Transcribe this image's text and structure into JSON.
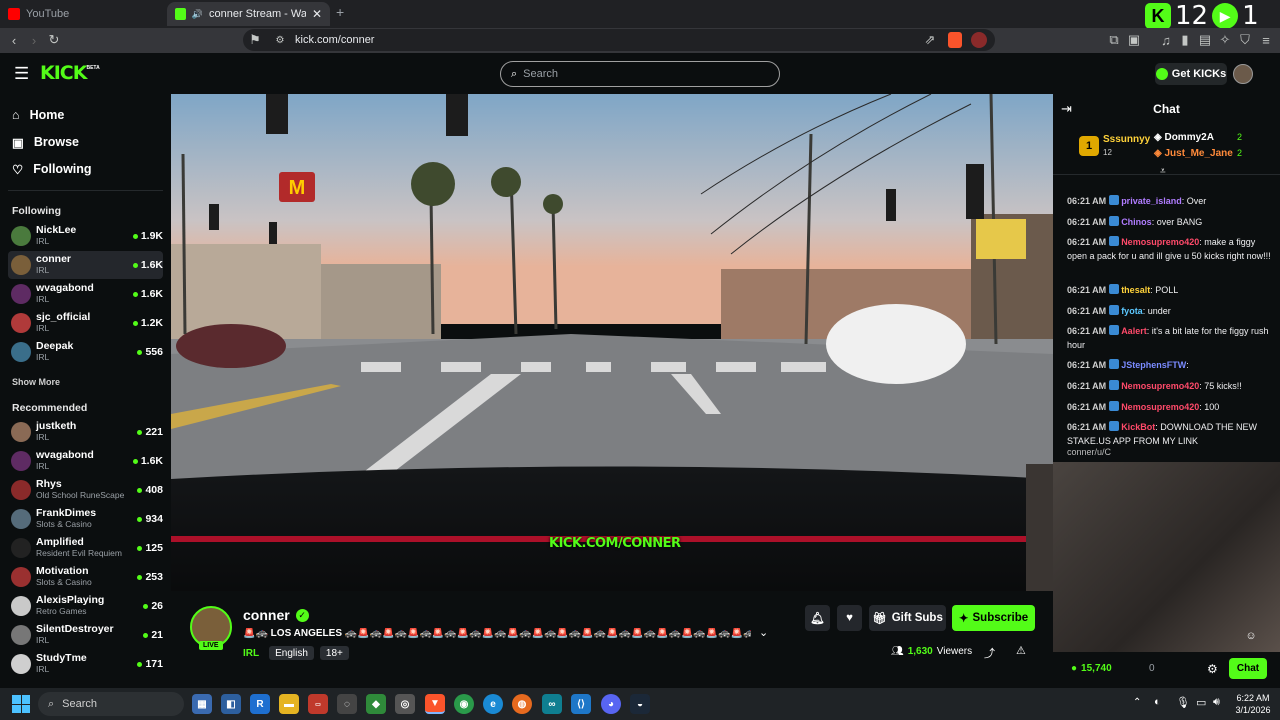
{
  "browser": {
    "tabs": [
      {
        "label": "YouTube"
      },
      {
        "label": "conner Stream - Watch Live o"
      }
    ],
    "new_tab": "+",
    "url": "kick.com/conner"
  },
  "overlay_score": {
    "left": "12",
    "right": "1"
  },
  "kick": {
    "logo": "KICK",
    "logo_beta": "BETA",
    "search_placeholder": "Search",
    "get_kicks": "Get KICKs",
    "nav": [
      {
        "label": "Home",
        "icon": "home-icon"
      },
      {
        "label": "Browse",
        "icon": "browse-icon"
      },
      {
        "label": "Following",
        "icon": "heart-icon"
      }
    ],
    "following_heading": "Following",
    "following": [
      {
        "name": "NickLee",
        "category": "IRL",
        "viewers": "1.9K",
        "color": "#4a7a3d"
      },
      {
        "name": "conner",
        "category": "IRL",
        "viewers": "1.6K",
        "color": "#7a5f3a"
      },
      {
        "name": "wvagabond",
        "category": "IRL",
        "viewers": "1.6K",
        "color": "#5e2b63"
      },
      {
        "name": "sjc_official",
        "category": "IRL",
        "viewers": "1.2K",
        "color": "#b03a3a"
      },
      {
        "name": "Deepak",
        "category": "IRL",
        "viewers": "556",
        "color": "#3a6e8a"
      }
    ],
    "show_more": "Show More",
    "recommended_heading": "Recommended",
    "recommended": [
      {
        "name": "justketh",
        "category": "IRL",
        "viewers": "221",
        "color": "#8a6a55"
      },
      {
        "name": "wvagabond",
        "category": "IRL",
        "viewers": "1.6K",
        "color": "#5e2b63"
      },
      {
        "name": "Rhys",
        "category": "Old School RuneScape",
        "viewers": "408",
        "color": "#8a2a2a"
      },
      {
        "name": "FrankDimes",
        "category": "Slots & Casino",
        "viewers": "934",
        "color": "#556b7a"
      },
      {
        "name": "Amplified",
        "category": "Resident Evil Requiem",
        "viewers": "125",
        "color": "#222222"
      },
      {
        "name": "Motivation",
        "category": "Slots & Casino",
        "viewers": "253",
        "color": "#9a3030"
      },
      {
        "name": "AlexisPlaying",
        "category": "Retro Games",
        "viewers": "26",
        "color": "#c9c9c9"
      },
      {
        "name": "SilentDestroyer",
        "category": "IRL",
        "viewers": "21",
        "color": "#777777"
      },
      {
        "name": "StudyTme",
        "category": "IRL",
        "viewers": "171",
        "color": "#cfcfcf"
      }
    ],
    "video_watermark": "KICK.COM/CONNER",
    "stream": {
      "streamer": "conner",
      "live_label": "LIVE",
      "title": "🚨🚓 LOS ANGELES 🚓🚨🚓🚨🚓🚨🚓🚨🚓🚨🚓🚨🚓🚨🚓🚨🚓🚨🚓🚨🚓🚨🚓🚨🚓🚨🚓🚨🚓🚨🚓🚨🚓🚨...",
      "tags": [
        "IRL",
        "English",
        "18+"
      ],
      "viewers": "1,630",
      "viewers_label": "Viewers",
      "gift_subs": "Gift Subs",
      "subscribe": "Subscribe"
    },
    "chat": {
      "title": "Chat",
      "leaderboard": {
        "first": {
          "rank": "1",
          "name": "Sssunnyy",
          "count": "12"
        },
        "second": {
          "name": "Dommy2A",
          "count": "2"
        },
        "third": {
          "name": "Just_Me_Jane",
          "count": "2"
        }
      },
      "messages": [
        {
          "time": "06:21 AM",
          "user": "private_island",
          "text": ": Over",
          "color": "#b07cff"
        },
        {
          "time": "06:21 AM",
          "user": "Chinos",
          "text": ": over BANG",
          "color": "#b07cff"
        },
        {
          "time": "06:21 AM",
          "user": "Nemosupremo420",
          "text": ": make a figgy open a pack for u and ill give u 50 kicks right now!!!",
          "color": "#ff4a6a"
        },
        {
          "time": "06:21 AM",
          "user": "thesalt",
          "text": ": POLL",
          "color": "#ffd23a"
        },
        {
          "time": "06:21 AM",
          "user": "fyota",
          "text": ": under",
          "color": "#5cc8ff"
        },
        {
          "time": "06:21 AM",
          "user": "Aalert",
          "text": ": it's a bit late for the figgy rush hour",
          "color": "#ff4a6a"
        },
        {
          "time": "06:21 AM",
          "user": "JStephensFTW",
          "text": ":",
          "color": "#7a8bff"
        },
        {
          "time": "06:21 AM",
          "user": "Nemosupremo420",
          "text": ": 75 kicks!!",
          "color": "#ff4a6a"
        },
        {
          "time": "06:21 AM",
          "user": "Nemosupremo420",
          "text": ": 100",
          "color": "#ff4a6a"
        },
        {
          "time": "06:21 AM",
          "user": "KickBot",
          "text": ": DOWNLOAD THE NEW STAKE.US APP FROM MY LINK",
          "color": "#ff4a6a"
        }
      ],
      "link_fragment": "conner/u/C",
      "points": "15,740",
      "points_right": "0",
      "chat_button": "Chat"
    }
  },
  "taskbar": {
    "search": "Search",
    "time": "6:22 AM",
    "date": "3/1/2026"
  },
  "colors": {
    "kick_green": "#53fc18",
    "bg": "#0b0e0f"
  }
}
